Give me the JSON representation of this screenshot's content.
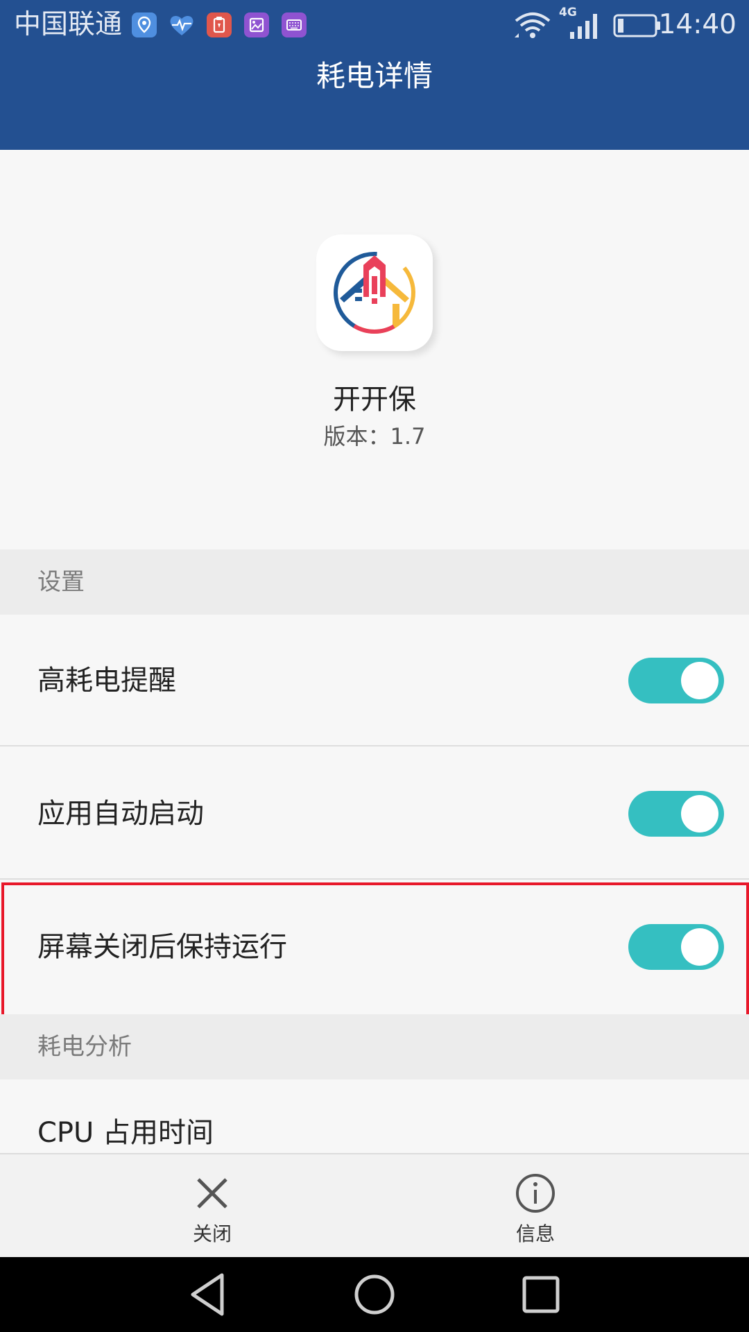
{
  "status_bar": {
    "carrier": "中国联通",
    "network": "4G",
    "time": "14:40",
    "notification_icons": [
      "location-icon",
      "health-icon",
      "clipboard-icon",
      "gallery-icon",
      "keyboard-icon"
    ]
  },
  "header": {
    "title": "耗电详情"
  },
  "app": {
    "name": "开开保",
    "version": "版本：1.7"
  },
  "sections": {
    "settings": "设置",
    "analysis": "耗电分析"
  },
  "settings": [
    {
      "label": "高耗电提醒",
      "enabled": true
    },
    {
      "label": "应用自动启动",
      "enabled": true
    },
    {
      "label": "屏幕关闭后保持运行",
      "enabled": true
    }
  ],
  "analysis_items": [
    {
      "label": "CPU 占用时间"
    }
  ],
  "actions": {
    "close": "关闭",
    "info": "信息"
  },
  "colors": {
    "header_bg": "#235091",
    "toggle_on": "#35bfc1",
    "highlight": "#e8182a"
  }
}
